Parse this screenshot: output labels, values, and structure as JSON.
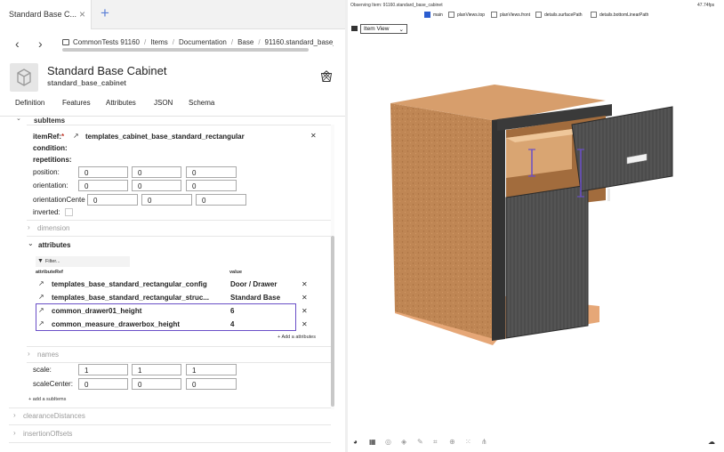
{
  "tab": {
    "title": "Standard Base C...",
    "close": "×",
    "add": "+"
  },
  "nav": {
    "back": "‹",
    "forward": "›"
  },
  "breadcrumbs": [
    "CommonTests 91160",
    "Items",
    "Documentation",
    "Base",
    "91160.standard_base_ca"
  ],
  "item": {
    "title": "Standard Base Cabinet",
    "subtitle": "standard_base_cabinet"
  },
  "section_tabs": [
    "Definition",
    "Features",
    "Attributes",
    "JSON",
    "Schema"
  ],
  "subitems": {
    "header": "subItems",
    "item_ref_label": "itemRef:",
    "item_ref_required": "*",
    "item_ref_value": "templates_cabinet_base_standard_rectangular",
    "condition_label": "condition:",
    "repetitions_label": "repetitions:",
    "position": {
      "label": "position:",
      "values": [
        "0",
        "0",
        "0"
      ]
    },
    "orientation": {
      "label": "orientation:",
      "values": [
        "0",
        "0",
        "0"
      ]
    },
    "orientation_center": {
      "label": "orientationCente",
      "values": [
        "0",
        "0",
        "0"
      ]
    },
    "inverted_label": "inverted:",
    "dimension_label": "dimension",
    "attributes": {
      "label": "attributes",
      "filter_placeholder": "Filter...",
      "col_ref": "attributeRef",
      "col_value": "value",
      "rows": [
        {
          "ref": "templates_base_standard_rectangular_config",
          "value": "Door / Drawer"
        },
        {
          "ref": "templates_base_standard_rectangular_struc...",
          "value": "Standard Base"
        },
        {
          "ref": "common_drawer01_height",
          "value": "6"
        },
        {
          "ref": "common_measure_drawerbox_height",
          "value": "4"
        }
      ],
      "add_label": "Add a attributes"
    },
    "names_label": "names",
    "scale": {
      "label": "scale:",
      "values": [
        "1",
        "1",
        "1"
      ]
    },
    "scale_center": {
      "label": "scaleCenter:",
      "values": [
        "0",
        "0",
        "0"
      ]
    },
    "add_subitem_label": "add a subItems"
  },
  "collapsed_sections": [
    "clearanceDistances",
    "insertionOffsets"
  ],
  "viewer": {
    "observing": "Observing Item: 91160.standard_base_cabinet",
    "fps": "47.74fps",
    "layers": [
      {
        "label": "main",
        "checked": true
      },
      {
        "label": "planViews.top",
        "checked": false
      },
      {
        "label": "planViews.front",
        "checked": false
      },
      {
        "label": "details.surfacePath",
        "checked": false
      },
      {
        "label": "details.bottomLinearPath",
        "checked": false
      }
    ],
    "view_mode": "Item View"
  },
  "colors": {
    "accent": "#2b5dd0",
    "highlight": "#6a4fc7",
    "wood": "#c08a5a",
    "panel": "#4a4a4a"
  }
}
